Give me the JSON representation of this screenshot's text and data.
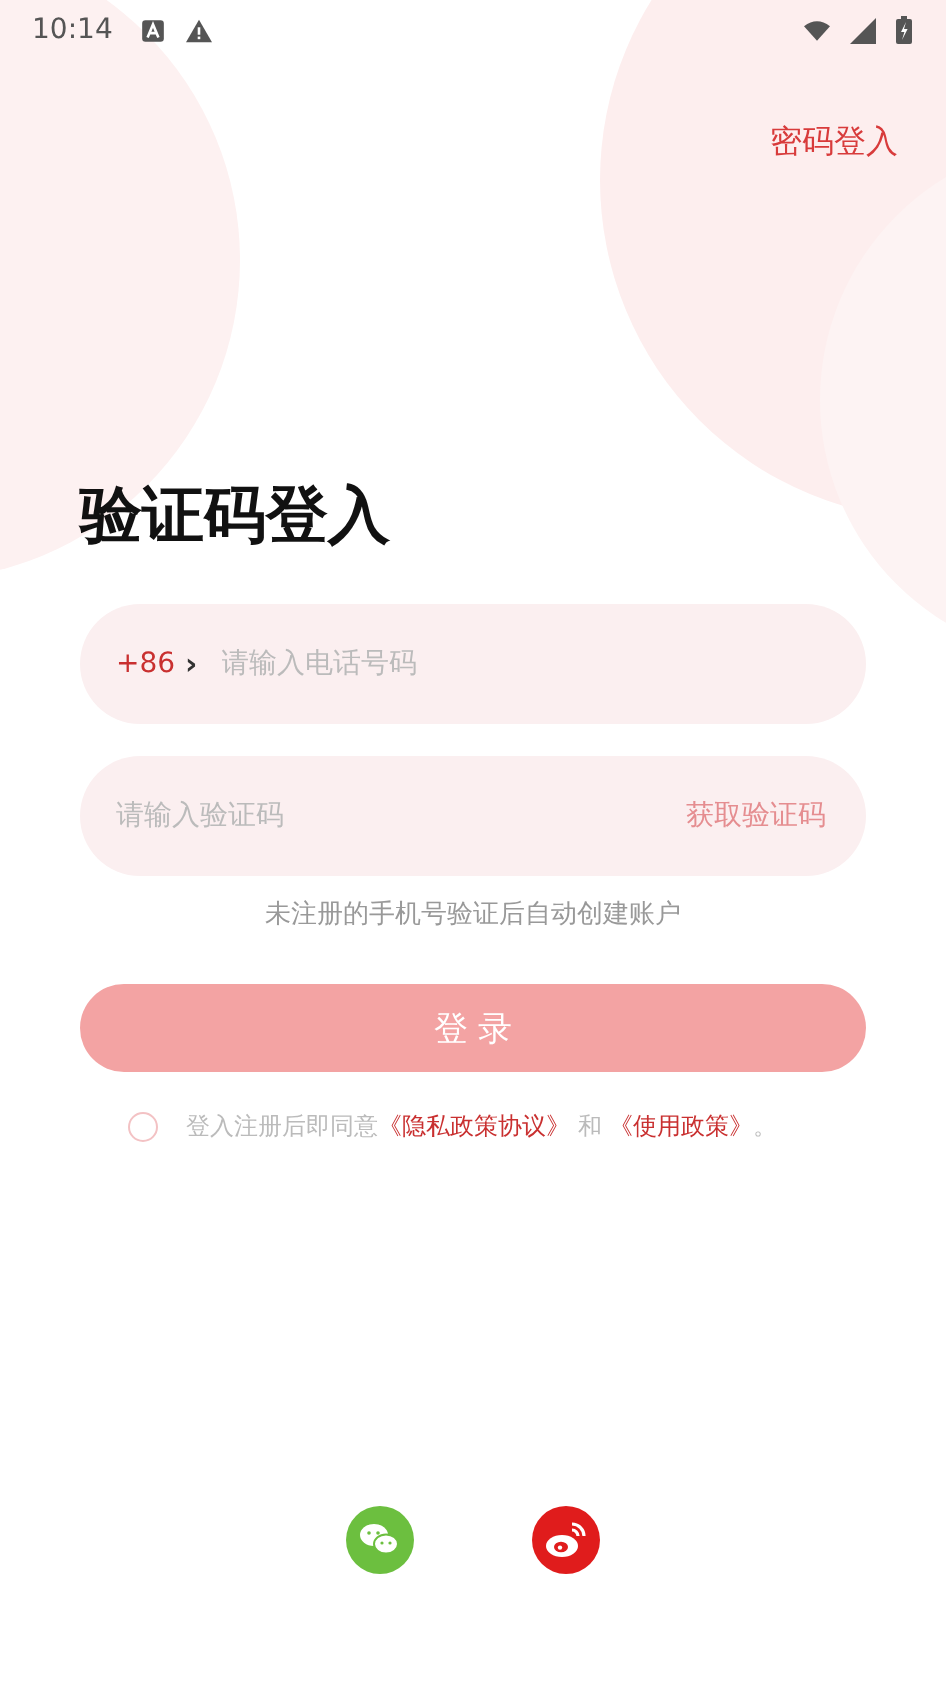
{
  "status_bar": {
    "time": "10:14"
  },
  "header": {
    "switch_link": "密码登入"
  },
  "title": "验证码登入",
  "phone_field": {
    "country_code": "+86",
    "chevron": "›",
    "placeholder": "请输入电话号码"
  },
  "code_field": {
    "placeholder": "请输入验证码",
    "action": "获取验证码"
  },
  "hint": "未注册的手机号验证后自动创建账户",
  "login_button": {
    "label": "登 录",
    "disabled": true
  },
  "agreement": {
    "checked": false,
    "text": "登入注册后即同意",
    "link_1": "《隐私政策协议》",
    "joiner": "和",
    "link_2": "《使用政策》",
    "end": "。"
  },
  "social": [
    {
      "kind": "wechat"
    },
    {
      "kind": "weibo"
    }
  ]
}
